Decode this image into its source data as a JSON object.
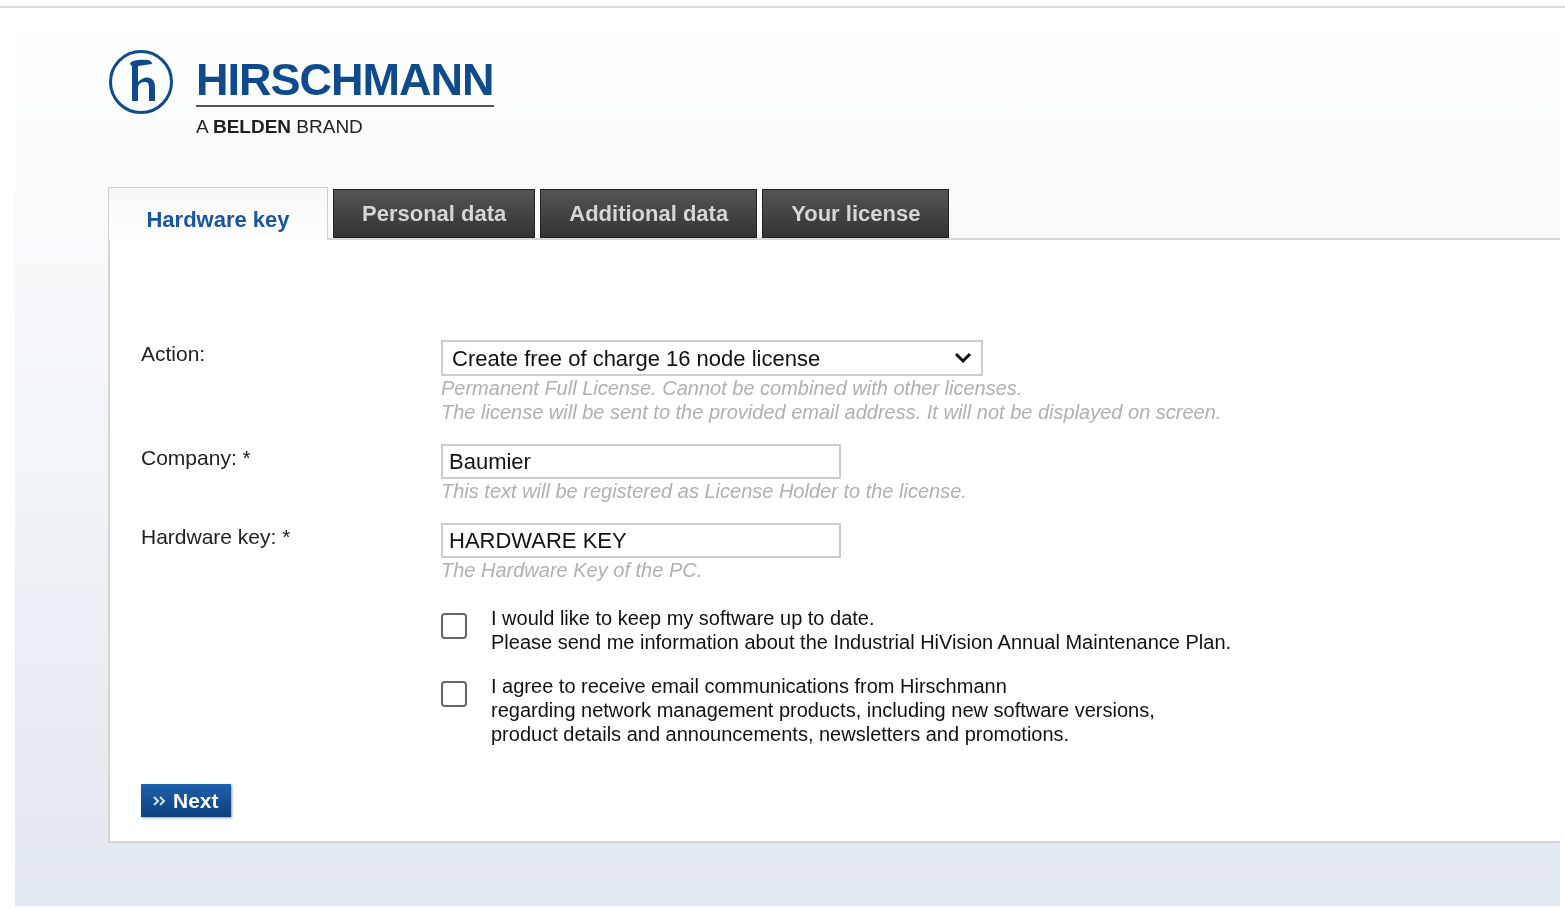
{
  "logo": {
    "name": "HIRSCHMANN",
    "tagline": "A **BELDEN** BRAND"
  },
  "tabs": [
    {
      "label": "Hardware key",
      "selected": true
    },
    {
      "label": "Personal data",
      "selected": false
    },
    {
      "label": "Additional data",
      "selected": false
    },
    {
      "label": "Your license",
      "selected": false
    }
  ],
  "fields": [
    {
      "kind": "select",
      "label": "Action:",
      "value": "Create free of charge 16 node license",
      "hints": [
        "Permanent Full License. Cannot be combined with other licenses.",
        "The license will be sent to the provided email address. It will not be displayed on screen."
      ]
    },
    {
      "kind": "text",
      "label": "Company: *",
      "value": "Baumier",
      "hints": [
        "This text will be registered as License Holder to the license."
      ]
    },
    {
      "kind": "text",
      "label": "Hardware key: *",
      "value": "HARDWARE KEY",
      "hints": [
        "The Hardware Key of the PC."
      ]
    }
  ],
  "checkboxes": [
    {
      "checked": false,
      "lines": [
        "I would like to keep my software up to date.",
        "Please send me information about the Industrial HiVision Annual Maintenance Plan."
      ]
    },
    {
      "checked": false,
      "lines": [
        "I agree to receive email communications from Hirschmann",
        "regarding network management products, including new software versions,",
        "product details and announcements, newsletters and promotions."
      ]
    }
  ],
  "next_button": "Next"
}
